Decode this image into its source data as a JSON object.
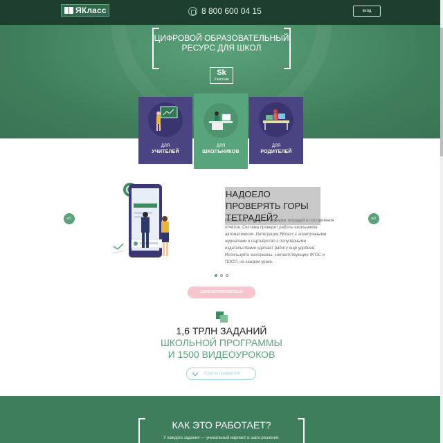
{
  "header": {
    "logo": "ЯКласс",
    "phone": "8 800 600 04 15",
    "login": "вход"
  },
  "hero": {
    "title": "ЦИФРОВОЙ ОБРАЗОВАТЕЛЬНЫЙ РЕСУРС ДЛЯ ШКОЛ",
    "badge_main": "Sk",
    "badge_sub": "Участник"
  },
  "roles": [
    {
      "pre": "ДЛЯ",
      "name": "УЧИТЕЛЕЙ",
      "active": false
    },
    {
      "pre": "ДЛЯ",
      "name": "ШКОЛЬНИКОВ",
      "active": true
    },
    {
      "pre": "ДЛЯ",
      "name": "РОДИТЕЛЕЙ",
      "active": false
    }
  ],
  "slider": {
    "prev_label": "п/1",
    "next_label": "п/2",
    "title": "НАДОЕЛО ПРОВЕРЯТЬ ГОРЫ ТЕТРАДЕЙ?",
    "text": "Избавьтесь от рутины проверки тетрадей и составления отчётов. Система проверит работы школьников автоматически. Интеграция ЯКласс с электронными журналами и партнёрство с популярными издательствами сделают работу ещё удобнее. Используйте материалы, соответствующие ФГОС и ПООП, на каждом уроке."
  },
  "register_button": "ЗАРЕГИСТРИРОВАТЬСЯ",
  "stats": {
    "line1": "1,6 ТРЛН ЗАДАНИЙ",
    "line2": "ШКОЛЬНОЙ ПРОГРАММЫ",
    "line3": "И 1500 ВИДЕОУРОКОВ"
  },
  "subjects_button": "Список предметов",
  "how": {
    "title": "КАК ЭТО РАБОТАЕТ?",
    "text": "У каждого задания — уникальный вариант и шаги решения."
  },
  "colors": {
    "header_bg": "#1f3f2e",
    "hero_green": "#4a8d68",
    "card_purple": "#4a4482",
    "card_active": "#58a57c",
    "accent_pink": "#f5c6cc"
  }
}
